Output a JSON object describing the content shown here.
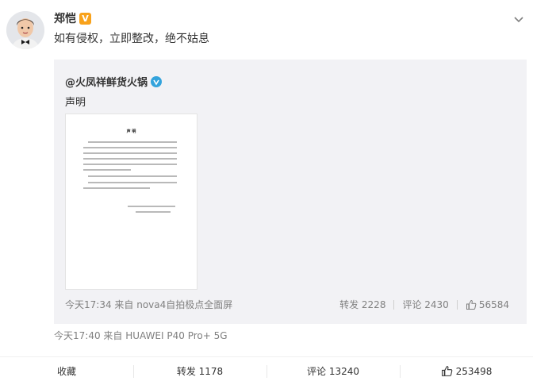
{
  "post": {
    "user": {
      "name": "郑恺",
      "badge_color": "#f8a21b",
      "avatar_icon": "boy-in-bowtie-avatar"
    },
    "text": "如有侵权，立即整改，绝不姑息",
    "meta": "今天17:40 来自 HUAWEI P40 Pro+ 5G",
    "more_icon": "chevron-down-icon"
  },
  "repost": {
    "user": "@火凤祥鲜货火锅",
    "badge_color": "#33a3dc",
    "text": "声明",
    "image": {
      "title": "声 明"
    },
    "meta": "今天17:34 来自 nova4自拍极点全面屏",
    "forward": "转发 2228",
    "comment": "评论 2430",
    "likes": "56584"
  },
  "actions": {
    "favorite": "收藏",
    "forward": "转发 1178",
    "comment": "评论 13240",
    "likes": "253498"
  }
}
